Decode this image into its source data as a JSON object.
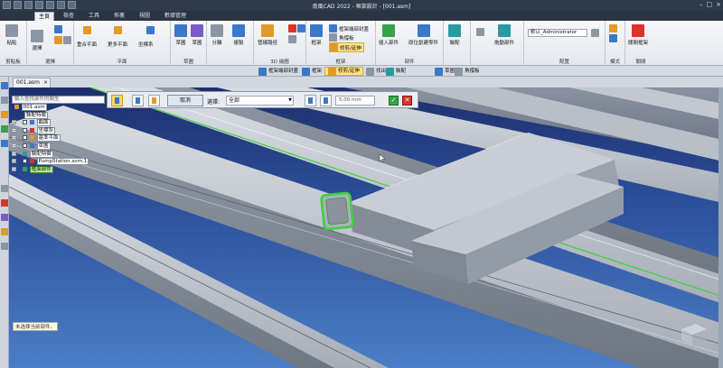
{
  "window": {
    "title": "南風CAD 2022 - 框架設計 - [001.asm]",
    "buttons": [
      "–",
      "□",
      "×"
    ]
  },
  "menu": {
    "tabs": [
      "主頁",
      "檢查",
      "工具",
      "佈裏",
      "視圖",
      "數據管理"
    ],
    "active": "主頁"
  },
  "ribbon": {
    "groups": [
      {
        "label": "剪貼板",
        "buttons": [
          "粘貼"
        ]
      },
      {
        "label": "選擇",
        "buttons": [
          "選擇"
        ]
      },
      {
        "label": "平面",
        "buttons": [
          "重合平面",
          "更多平面",
          "坐標系"
        ]
      },
      {
        "label": "草圖",
        "buttons": [
          "草圖",
          "草圖"
        ]
      },
      {
        "label": "",
        "buttons": [
          "分離",
          "複製"
        ]
      },
      {
        "label": "3D 繪圖",
        "buttons": [
          "管線路徑"
        ]
      },
      {
        "label": "框架",
        "buttons": [
          "框架",
          "框架端部封蓋",
          "角撐板",
          "修剪/延伸"
        ]
      },
      {
        "label": "部件",
        "buttons": [
          "插入部件",
          "原位創建零件"
        ]
      },
      {
        "label": "",
        "buttons": [
          "裝配"
        ]
      },
      {
        "label": "",
        "buttons": [
          "拖動部件"
        ]
      },
      {
        "label": "配置",
        "buttons": []
      },
      {
        "label": "模式",
        "buttons": [
          "模式"
        ]
      },
      {
        "label": "關閉",
        "buttons": [
          "關閉框架"
        ]
      }
    ],
    "config_combo": "默认_Administrator"
  },
  "context_toolbar": {
    "items": [
      "框架端部封蓋",
      "框架",
      "修剪/延伸",
      "找出",
      "裝配",
      "草圖",
      "角撐板"
    ],
    "active": "修剪/延伸"
  },
  "document": {
    "tab": "001.asm"
  },
  "trim_panel": {
    "cancel_label": "取消",
    "select_label": "選擇:",
    "select_value": "全部",
    "distance_value": "5.00 mm",
    "ok_label": "✓",
    "cancel_icon": "✕"
  },
  "tree": {
    "search_placeholder": "輸入查找部件的類型",
    "nodes": [
      {
        "label": "001.asm",
        "indent": 0,
        "highlight": false
      },
      {
        "label": "裝配特徵",
        "indent": 1,
        "highlight": false
      },
      {
        "label": "曲面",
        "indent": 1,
        "highlight": false
      },
      {
        "label": "坐標系",
        "indent": 1,
        "highlight": false
      },
      {
        "label": "基準平面",
        "indent": 1,
        "highlight": false
      },
      {
        "label": "草圖",
        "indent": 1,
        "highlight": false
      },
      {
        "label": "裝配特徵",
        "indent": 1,
        "highlight": false
      },
      {
        "label": "PumpStation.asm:1",
        "indent": 1,
        "highlight": false
      },
      {
        "label": "框架部件",
        "indent": 1,
        "highlight": true
      }
    ]
  },
  "status": {
    "bottom_note": "未选择当前部件。"
  },
  "colors": {
    "accent": "#3b78c7",
    "highlight_green": "#3aa14b",
    "viewport_top": "#1d2f6b",
    "viewport_bottom": "#4b7ec6"
  }
}
